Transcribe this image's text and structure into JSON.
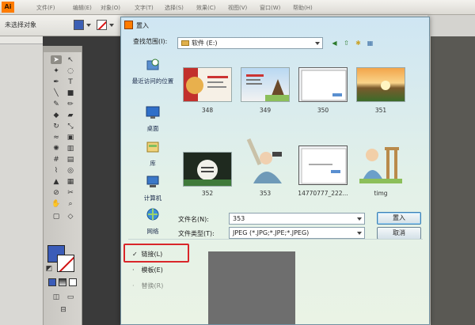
{
  "app": {
    "logo": "Ai",
    "menus": [
      "文件(F)",
      "编辑(E)",
      "对象(O)",
      "文字(T)",
      "选择(S)",
      "效果(C)",
      "视图(V)",
      "窗口(W)",
      "帮助(H)"
    ],
    "option_label": "未选择对象",
    "colors": {
      "fill": "#3c5fb4",
      "stroke_slash": "#d11111",
      "accent": "#ff7c00"
    }
  },
  "tools": {
    "icons": [
      "selection-arrow-icon",
      "direct-select-icon",
      "magic-wand-icon",
      "lasso-icon",
      "pen-icon",
      "type-icon",
      "line-icon",
      "rect-icon",
      "brush-icon",
      "pencil-icon",
      "blob-brush-icon",
      "eraser-icon",
      "rotate-icon",
      "scale-icon",
      "warp-icon",
      "free-transform-icon",
      "symbol-sprayer-icon",
      "graph-icon",
      "mesh-icon",
      "gradient-icon",
      "eyedropper-icon",
      "blend-icon",
      "live-paint-icon",
      "slice-icon",
      "hand-icon",
      "zoom-icon"
    ],
    "fill_color": "#3b5cb8",
    "stroke_color": "#ffffff"
  },
  "dialog": {
    "title": "置入",
    "look_in_label": "查找范围(I):",
    "look_in_value": "软件 (E:)",
    "places": [
      {
        "label": "最近访问的位置",
        "icon": "recent-places-icon"
      },
      {
        "label": "桌面",
        "icon": "desktop-icon"
      },
      {
        "label": "库",
        "icon": "libraries-icon"
      },
      {
        "label": "计算机",
        "icon": "computer-icon"
      },
      {
        "label": "网络",
        "icon": "network-icon"
      }
    ],
    "files": [
      {
        "name": "348"
      },
      {
        "name": "349"
      },
      {
        "name": "350"
      },
      {
        "name": "351"
      },
      {
        "name": "352"
      },
      {
        "name": "353"
      },
      {
        "name": "14770777_222..."
      },
      {
        "name": "timg"
      }
    ],
    "filename_label": "文件名(N):",
    "filename_value": "353",
    "filetype_label": "文件类型(T):",
    "filetype_value": "JPEG (*.JPG;*.JPE;*.JPEG)",
    "place_button": "置入",
    "cancel_button": "取消",
    "options": [
      {
        "label": "链接(L)",
        "checked": true
      },
      {
        "label": "模板(E)",
        "checked": false
      },
      {
        "label": "替换(R)",
        "checked": false
      }
    ]
  }
}
